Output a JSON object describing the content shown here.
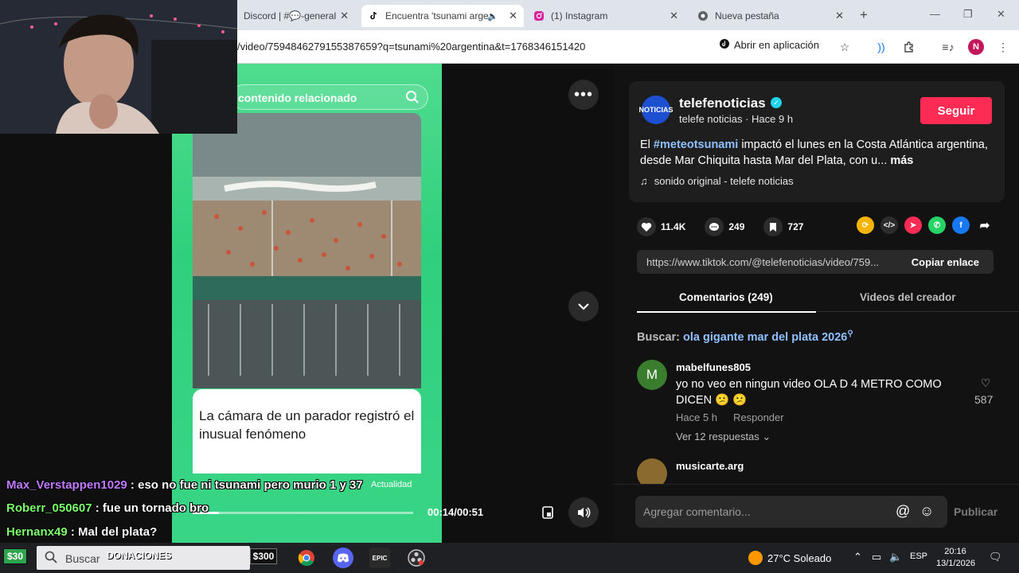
{
  "browser": {
    "tabs": [
      {
        "title": "Discord | #💬-general",
        "icon": "discord-icon",
        "active": false
      },
      {
        "title": "Encuentra 'tsunami arge",
        "icon": "tiktok-icon",
        "active": true
      },
      {
        "title": "(1) Instagram",
        "icon": "instagram-icon",
        "active": false
      },
      {
        "title": "Nueva pestaña",
        "icon": "chrome-icon",
        "active": false
      }
    ],
    "new_tab": "+",
    "url": "/video/7594846279155387659?q=tsunami%20argentina&t=1768346151420",
    "open_app_label": "Abrir en aplicación",
    "profile_initial": "N"
  },
  "video": {
    "search_pill": "contenido relacionado",
    "caption": "La cámara de un parador registró el inusual fenómeno",
    "category": "Actualidad",
    "time": "00:14/00:51",
    "progress": 0.12
  },
  "post": {
    "creator": "telefenoticias",
    "avatar_text": "NOTICIAS",
    "subtitle": "telefe noticias · Hace 9 h",
    "follow_label": "Seguir",
    "desc_prefix": "El ",
    "hashtag": "#meteotsunami",
    "desc_rest": " impactó el lunes en la Costa Atlántica argentina, desde Mar Chiquita hasta Mar del Plata, con u...",
    "more_label": "más",
    "sound": "sonido original - telefe noticias",
    "likes": "11.4K",
    "comments": "249",
    "saves": "727",
    "link": "https://www.tiktok.com/@telefenoticias/video/759...",
    "copy_label": "Copiar enlace"
  },
  "panel_tabs": {
    "comments": "Comentarios (249)",
    "creator_videos": "Videos del creador"
  },
  "search_suggest": {
    "label": "Buscar: ",
    "term": "ola gigante mar del plata 2026"
  },
  "comments": [
    {
      "avatar_letter": "M",
      "avatar_color": "#3a7d2f",
      "user": "mabelfunes805",
      "text": "yo no veo en ningun video OLA D 4 METRO COMO DICEN 😕 😕",
      "time": "Hace 5 h",
      "reply": "Responder",
      "replies": "Ver 12 respuestas ⌄",
      "likes": "587"
    },
    {
      "avatar_letter": "",
      "avatar_color": "#8a6a2e",
      "user": "musicarte.arg"
    }
  ],
  "comment_input": {
    "placeholder": "Agregar comentario...",
    "publish": "Publicar"
  },
  "stream_chat": [
    {
      "user": "Max_Verstappen1029",
      "color": "#c07bff",
      "message": " : eso no fue ni tsunami pero murio 1 y 37"
    },
    {
      "user": "Roberr_050607",
      "color": "#7dff6b",
      "message": " : fue un tornado bro"
    },
    {
      "user": "Hernanx49",
      "color": "#7dff6b",
      "message": " : Mal del plata?"
    }
  ],
  "taskbar": {
    "badge_left": "$30",
    "search_placeholder": "Buscar",
    "donaciones": "DONACIONES",
    "badge_mid": "$300",
    "weather": "27°C  Soleado",
    "lang": "ESP",
    "time": "20:16",
    "date": "13/1/2026"
  }
}
